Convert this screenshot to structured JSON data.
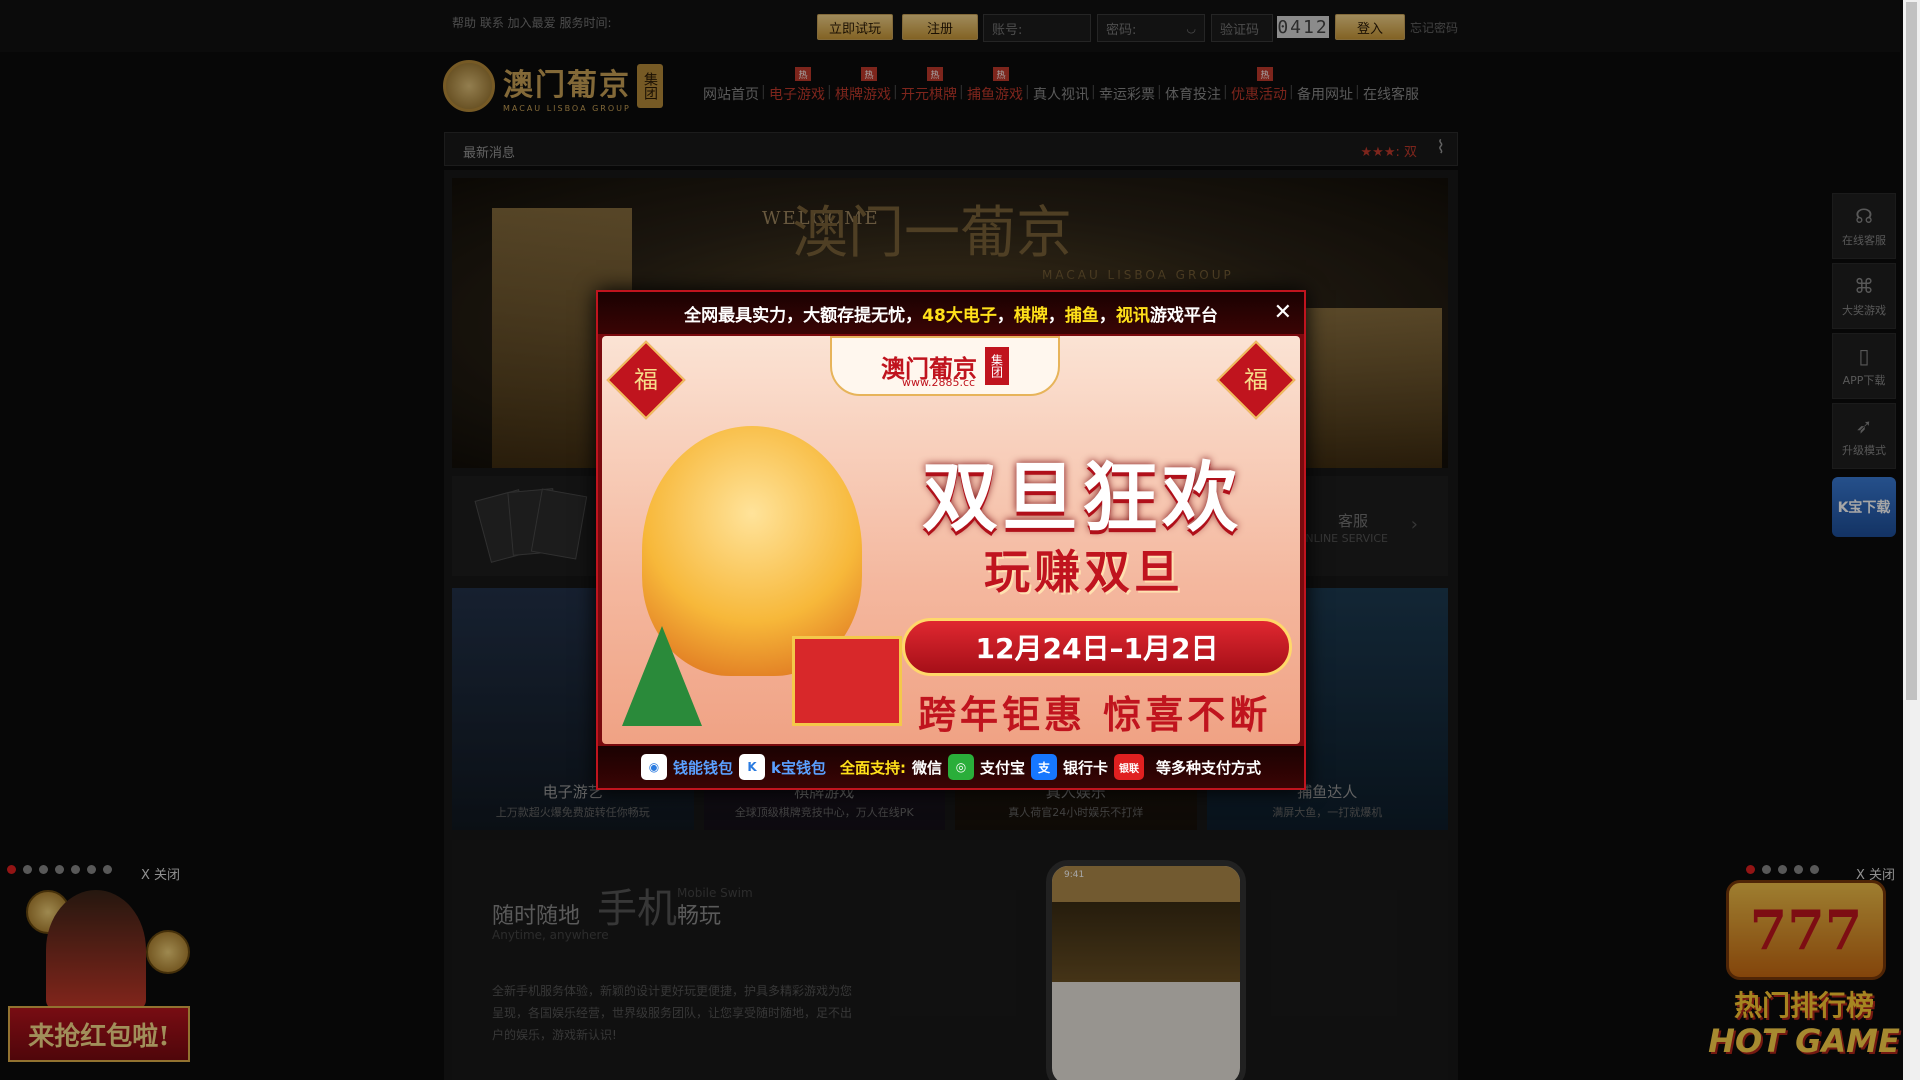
{
  "topbar": {
    "links": "帮助 联系 加入最爱 服务时间:",
    "try_btn": "立即试玩",
    "register_btn": "注册",
    "account_placeholder": "账号:",
    "password_placeholder": "密码:",
    "captcha_placeholder": "验证码",
    "captcha_code": "0412",
    "login_btn": "登入",
    "forgot": "忘记密码"
  },
  "logo": {
    "cn": "澳门葡京",
    "en": "MACAU LISBOA GROUP",
    "tag": "集团"
  },
  "nav": [
    {
      "label": "网站首页",
      "hot": ""
    },
    {
      "label": "电子游戏",
      "hot": "热"
    },
    {
      "label": "棋牌游戏",
      "hot": "热"
    },
    {
      "label": "开元棋牌",
      "hot": "热"
    },
    {
      "label": "捕鱼游戏",
      "hot": "热"
    },
    {
      "label": "真人视讯",
      "hot": ""
    },
    {
      "label": "幸运彩票",
      "hot": ""
    },
    {
      "label": "体育投注",
      "hot": ""
    },
    {
      "label": "优惠活动",
      "hot": "热"
    },
    {
      "label": "备用网址",
      "hot": ""
    },
    {
      "label": "在线客服",
      "hot": ""
    }
  ],
  "news": {
    "label": "最新消息",
    "text": "★★★: 双"
  },
  "banner": {
    "welcome": "WELCOME",
    "title": "澳门一葡京",
    "sub": "MACAU LISBOA GROUP"
  },
  "service": {
    "label": "客服",
    "sub": "ONLINE SERVICE"
  },
  "games": [
    {
      "title": "电子游艺",
      "sub": "上万款超火爆免费旋转任你畅玩"
    },
    {
      "title": "棋牌游戏",
      "sub": "全球顶级棋牌竞技中心，万人在线PK"
    },
    {
      "title": "真人娱乐",
      "sub": "真人荷官24小时娱乐不打烊"
    },
    {
      "title": "捕鱼达人",
      "sub": "满屏大鱼，一打就爆机"
    }
  ],
  "mobile": {
    "title1": "随时随地",
    "big": "手机",
    "title2": "畅玩",
    "en1": "Anytime, anywhere",
    "en2": "Mobile Swim",
    "desc": "全新手机服务体验，新颖的设计更好玩更便捷，护具多精彩游戏为您呈现，各国娱乐经营，世界级服务团队，让您享受随时随地，足不出户的娱乐，游戏新认识!",
    "phone_time": "9:41"
  },
  "rightbar": [
    {
      "icon": "headset-icon",
      "glyph": "☊",
      "label": "在线客服"
    },
    {
      "icon": "gamepad-icon",
      "glyph": "⌘",
      "label": "大奖游戏"
    },
    {
      "icon": "phone-icon",
      "glyph": "▯",
      "label": "APP下载"
    },
    {
      "icon": "rocket-icon",
      "glyph": "➶",
      "label": "升级模式"
    }
  ],
  "kbao": "K宝下载",
  "float_left": {
    "close": "X 关闭",
    "banner": "来抢红包啦!",
    "dots": 7,
    "active": 0
  },
  "float_right": {
    "close": "X 关闭",
    "slot": "777",
    "rank": "热门排行榜",
    "game": "HOT GAME",
    "dots": 5,
    "active": 0
  },
  "popup": {
    "head_a": "全网最具实力，大额存提无忧，",
    "head_b": "48大电子",
    "head_c": "，",
    "head_d": "棋牌",
    "head_e": "，",
    "head_f": "捕鱼",
    "head_g": "，",
    "head_h": "视讯",
    "head_i": "游戏平台",
    "logo_cn": "澳门葡京",
    "logo_url": "www.2885.cc",
    "logo_tag": "集团",
    "fu": "福",
    "title": "双旦狂欢",
    "subtitle": "玩赚双旦",
    "date": "12月24日–1月2日",
    "slogan": "跨年钜惠 惊喜不断",
    "foot": {
      "w1": "钱能钱包",
      "w2": "k宝钱包",
      "support": "全面支持:",
      "wechat": "微信",
      "alipay": "支付宝",
      "bank": "银行卡",
      "unionpay": "银联",
      "more": "等多种支付方式"
    }
  },
  "colors": {
    "gold": "#c9a45a",
    "red": "#c0141e",
    "yellow": "#ffe11a"
  }
}
